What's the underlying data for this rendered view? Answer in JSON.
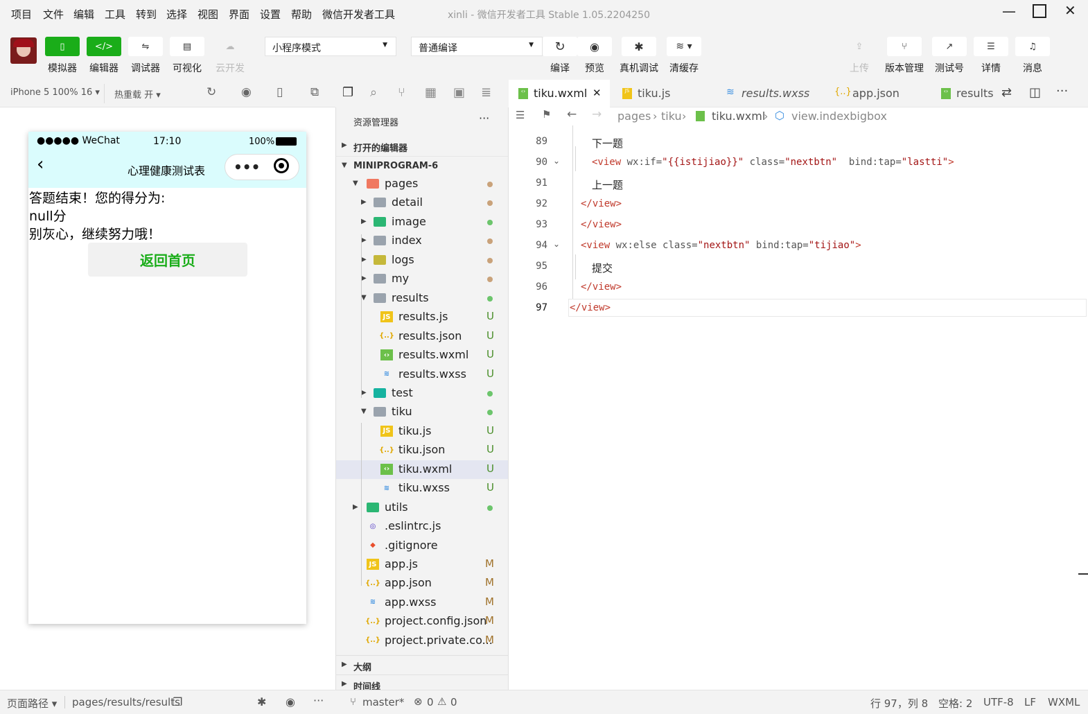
{
  "menubar": {
    "items": [
      "项目",
      "文件",
      "编辑",
      "工具",
      "转到",
      "选择",
      "视图",
      "界面",
      "设置",
      "帮助",
      "微信开发者工具"
    ],
    "window_title": "xinli - 微信开发者工具 Stable 1.05.2204250"
  },
  "toolbar": {
    "left": [
      "模拟器",
      "编辑器",
      "调试器",
      "可视化",
      "云开发"
    ],
    "mode_select": "小程序模式",
    "compile_select": "普通编译",
    "actions": [
      "编译",
      "预览",
      "真机调试",
      "清缓存"
    ],
    "right": [
      "上传",
      "版本管理",
      "测试号",
      "详情",
      "消息"
    ]
  },
  "simulator": {
    "device": "iPhone 5 100% 16 ▾",
    "hotreload": "热重载 开 ▾",
    "status_carrier": "●●●●● WeChat",
    "status_time": "17:10",
    "status_battery": "100%",
    "nav_title": "心理健康测试表",
    "result_line1": "答题结束！您的得分为:",
    "result_line2": "null分",
    "result_line3": "别灰心，继续努力哦！",
    "back_button": "返回首页"
  },
  "explorer": {
    "title": "资源管理器",
    "more": "···",
    "open_editors": "打开的编辑器",
    "project": "MINIPROGRAM-6",
    "items": [
      {
        "label": "pages",
        "status": "dot",
        "color": "#c9a27a"
      },
      {
        "label": "detail",
        "status": "dot",
        "color": "#c9a27a"
      },
      {
        "label": "image",
        "status": "dot",
        "color": "#6cc56c"
      },
      {
        "label": "index",
        "status": "dot",
        "color": "#c9a27a"
      },
      {
        "label": "logs",
        "status": "dot",
        "color": "#c9a27a"
      },
      {
        "label": "my",
        "status": "dot",
        "color": "#c9a27a"
      },
      {
        "label": "results",
        "status": "dot",
        "color": "#6cc56c"
      },
      {
        "label": "results.js",
        "status": "U"
      },
      {
        "label": "results.json",
        "status": "U"
      },
      {
        "label": "results.wxml",
        "status": "U"
      },
      {
        "label": "results.wxss",
        "status": "U"
      },
      {
        "label": "test",
        "status": "dot",
        "color": "#6cc56c"
      },
      {
        "label": "tiku",
        "status": "dot",
        "color": "#6cc56c"
      },
      {
        "label": "tiku.js",
        "status": "U"
      },
      {
        "label": "tiku.json",
        "status": "U"
      },
      {
        "label": "tiku.wxml",
        "status": "U"
      },
      {
        "label": "tiku.wxss",
        "status": "U"
      },
      {
        "label": "utils",
        "status": "dot",
        "color": "#6cc56c"
      },
      {
        "label": ".eslintrc.js",
        "status": ""
      },
      {
        "label": ".gitignore",
        "status": ""
      },
      {
        "label": "app.js",
        "status": "M"
      },
      {
        "label": "app.json",
        "status": "M"
      },
      {
        "label": "app.wxss",
        "status": "M"
      },
      {
        "label": "project.config.json",
        "status": "M"
      },
      {
        "label": "project.private.co...",
        "status": "M"
      }
    ],
    "outline": "大纲",
    "timeline": "时间线"
  },
  "editor": {
    "tabs": [
      "tiku.wxml",
      "tiku.js",
      "results.wxss",
      "app.json",
      "results.v"
    ],
    "breadcrumb": [
      "pages",
      "tiku",
      "tiku.wxml",
      "view.indexbigbox"
    ],
    "lines": [
      {
        "n": "89",
        "text": "下一题"
      },
      {
        "n": "90",
        "tag": "<view",
        "attrs": " wx:if=",
        "val1": "\"{{istijiao}}\"",
        "attrs2": " class=",
        "val2": "\"nextbtn\"",
        "attrs3": "  bind:tap=",
        "val3": "\"lastti\"",
        "end": ">"
      },
      {
        "n": "91",
        "text": "上一题"
      },
      {
        "n": "92",
        "close": "</view>"
      },
      {
        "n": "93",
        "close": "</view>"
      },
      {
        "n": "94",
        "tag": "<view",
        "attrs": " wx:else class=",
        "val1": "\"nextbtn\"",
        "attrs2": " bind:tap=",
        "val2": "\"tijiao\"",
        "end": ">"
      },
      {
        "n": "95",
        "text": "提交"
      },
      {
        "n": "96",
        "close": "</view>"
      },
      {
        "n": "97",
        "close": "</view>"
      }
    ]
  },
  "statusbar": {
    "page_path_label": "页面路径 ▾",
    "page_path": "pages/results/results",
    "branch": "master*",
    "errors": "0",
    "warnings": "0",
    "cursor": "行 97，列 8",
    "indent": "空格: 2",
    "encoding": "UTF-8",
    "eol": "LF",
    "lang": "WXML"
  }
}
